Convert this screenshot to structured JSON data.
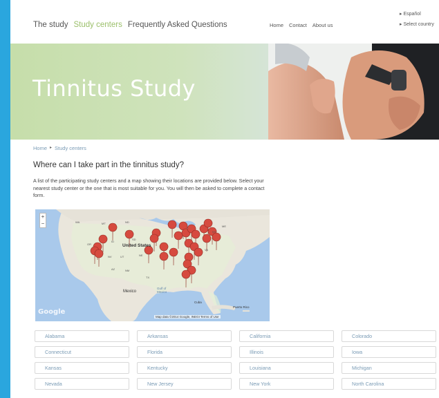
{
  "nav": {
    "items": [
      "The study",
      "Study centers",
      "Frequently Asked Questions"
    ],
    "active": "Study centers"
  },
  "secondary_nav": [
    "Home",
    "Contact",
    "About us"
  ],
  "language": {
    "espanol": "▸ Español",
    "select_country": "▸ Select country"
  },
  "hero": {
    "title": "Tinnitus Study"
  },
  "breadcrumb": {
    "home": "Home",
    "separator": "▸",
    "current": "Study centers"
  },
  "page": {
    "heading": "Where can I take part in the tinnitus study?",
    "intro": "A list of the participating study centers and a map showing their locations are provided below. Select your nearest study center or the one that is most suitable for you. You will then be asked to complete a contact form."
  },
  "map": {
    "zoom_in": "+",
    "zoom_out": "−",
    "labels": {
      "united_states": "United States",
      "mexico": "Mexico",
      "gulf": "Gulf of Mexico",
      "cuba": "Cuba",
      "puerto_rico": "Puerto Rico"
    },
    "attribution": "Map data ©2014 Google, INEGI   Terms of Use",
    "logo": "Google"
  },
  "states": [
    "Alabama",
    "Arkansas",
    "California",
    "Colorado",
    "Connecticut",
    "Florida",
    "Illinois",
    "Iowa",
    "Kansas",
    "Kentucky",
    "Louisiana",
    "Michigan",
    "Nevada",
    "New Jersey",
    "New York",
    "North Carolina"
  ],
  "colors": {
    "background": "#2aa6de",
    "accent": "#9bbf6a",
    "link": "#7a9bb5",
    "pin": "#d64a3f"
  }
}
